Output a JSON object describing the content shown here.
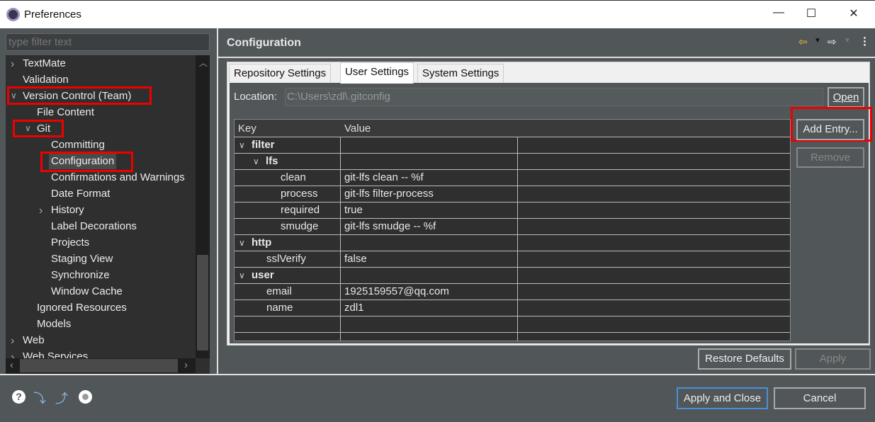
{
  "window": {
    "title": "Preferences",
    "minimize": "—",
    "maximize": "☐",
    "close": "✕"
  },
  "filter": {
    "placeholder": "type filter text"
  },
  "tree": [
    {
      "label": "TextMate",
      "level": 0,
      "chevron": "›"
    },
    {
      "label": "Validation",
      "level": 0,
      "chevron": ""
    },
    {
      "label": "Version Control (Team)",
      "level": 0,
      "chevron": "⌄"
    },
    {
      "label": "File Content",
      "level": 1,
      "chevron": ""
    },
    {
      "label": "Git",
      "level": 1,
      "chevron": "⌄"
    },
    {
      "label": "Committing",
      "level": 2,
      "chevron": ""
    },
    {
      "label": "Configuration",
      "level": 2,
      "chevron": "",
      "selected": true
    },
    {
      "label": "Confirmations and Warnings",
      "level": 2,
      "chevron": ""
    },
    {
      "label": "Date Format",
      "level": 2,
      "chevron": ""
    },
    {
      "label": "History",
      "level": 2,
      "chevron": "›"
    },
    {
      "label": "Label Decorations",
      "level": 2,
      "chevron": ""
    },
    {
      "label": "Projects",
      "level": 2,
      "chevron": ""
    },
    {
      "label": "Staging View",
      "level": 2,
      "chevron": ""
    },
    {
      "label": "Synchronize",
      "level": 2,
      "chevron": ""
    },
    {
      "label": "Window Cache",
      "level": 2,
      "chevron": ""
    },
    {
      "label": "Ignored Resources",
      "level": 1,
      "chevron": ""
    },
    {
      "label": "Models",
      "level": 1,
      "chevron": ""
    },
    {
      "label": "Web",
      "level": 0,
      "chevron": "›"
    },
    {
      "label": "Web Services",
      "level": 0,
      "chevron": "›"
    }
  ],
  "page": {
    "title": "Configuration"
  },
  "tabs": [
    {
      "label": "Repository Settings"
    },
    {
      "label": "User Settings",
      "active": true
    },
    {
      "label": "System Settings"
    }
  ],
  "location": {
    "label": "Location:",
    "value": "C:\\Users\\zdl\\.gitconfig",
    "open": "Open"
  },
  "table": {
    "headers": [
      "Key",
      "Value"
    ],
    "rows": [
      {
        "key": "filter",
        "value": "",
        "level": 0,
        "section": true
      },
      {
        "key": "lfs",
        "value": "",
        "level": 1,
        "section": true
      },
      {
        "key": "clean",
        "value": "git-lfs clean -- %f",
        "level": 2
      },
      {
        "key": "process",
        "value": "git-lfs filter-process",
        "level": 2
      },
      {
        "key": "required",
        "value": "true",
        "level": 2
      },
      {
        "key": "smudge",
        "value": "git-lfs smudge -- %f",
        "level": 2
      },
      {
        "key": "http",
        "value": "",
        "level": 0,
        "section": true
      },
      {
        "key": "sslVerify",
        "value": "false",
        "level": 1
      },
      {
        "key": "user",
        "value": "",
        "level": 0,
        "section": true
      },
      {
        "key": "email",
        "value": "1925159557@qq.com",
        "level": 1
      },
      {
        "key": "name",
        "value": "zdl1",
        "level": 1
      }
    ]
  },
  "buttons": {
    "add_entry": "Add Entry...",
    "remove": "Remove",
    "restore_defaults": "Restore Defaults",
    "apply": "Apply",
    "apply_and_close": "Apply and Close",
    "cancel": "Cancel"
  },
  "colors": {
    "highlight": "#ee0000",
    "background": "#515658",
    "tree_bg": "#2f2f2f"
  }
}
